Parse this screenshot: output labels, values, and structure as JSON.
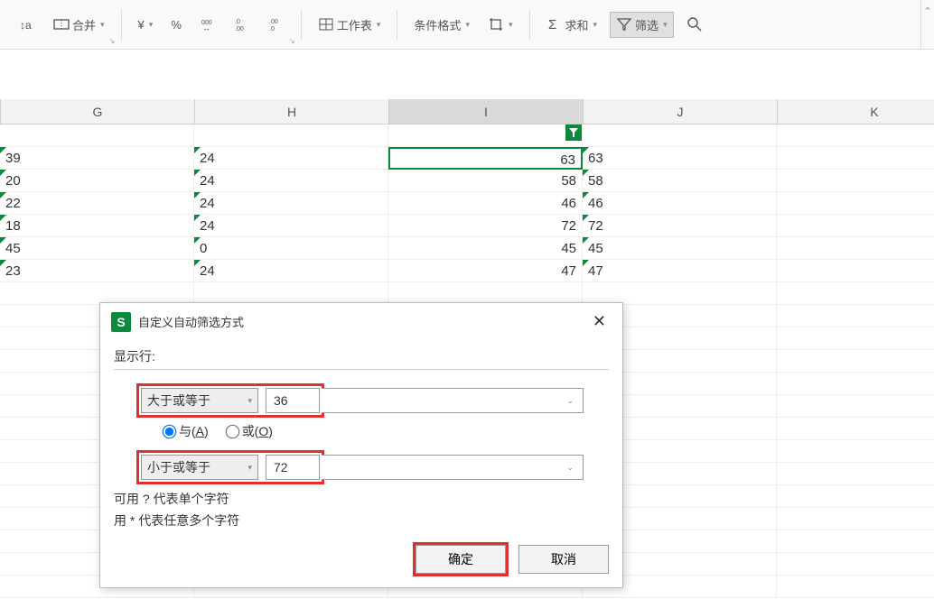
{
  "toolbar": {
    "merge_label": "合并",
    "currency": "¥",
    "percent": "%",
    "comma_icon": "000",
    "dec_inc": ".00",
    "dec_dec": ".0",
    "worksheet_label": "工作表",
    "cond_format_label": "条件格式",
    "crop_icon": "crop",
    "sum_label": "求和",
    "filter_label": "筛选",
    "search_icon": "search"
  },
  "columns": [
    "G",
    "H",
    "I",
    "J",
    "K"
  ],
  "selected_column_index": 2,
  "rows": [
    {
      "cells": [
        "",
        "",
        "",
        "",
        ""
      ],
      "filter_row": true
    },
    {
      "cells": [
        "39",
        "24",
        "63",
        "63",
        ""
      ]
    },
    {
      "cells": [
        "20",
        "24",
        "58",
        "58",
        ""
      ]
    },
    {
      "cells": [
        "22",
        "24",
        "46",
        "46",
        ""
      ]
    },
    {
      "cells": [
        "18",
        "24",
        "72",
        "72",
        ""
      ]
    },
    {
      "cells": [
        "45",
        "0",
        "45",
        "45",
        ""
      ]
    },
    {
      "cells": [
        "23",
        "24",
        "47",
        "47",
        ""
      ]
    }
  ],
  "green_triangle_cols": [
    0,
    1,
    3
  ],
  "right_align_cols": [
    2
  ],
  "selected_cell": {
    "row": 1,
    "col": 2
  },
  "dialog": {
    "title": "自定义自动筛选方式",
    "show_rows_label": "显示行:",
    "condition1_op": "大于或等于",
    "condition1_val": "36",
    "radio_and": "与(A)",
    "radio_or": "或(O)",
    "radio_selected": "and",
    "condition2_op": "小于或等于",
    "condition2_val": "72",
    "help_line1": "可用 ? 代表单个字符",
    "help_line2": "用 * 代表任意多个字符",
    "ok_label": "确定",
    "cancel_label": "取消"
  }
}
